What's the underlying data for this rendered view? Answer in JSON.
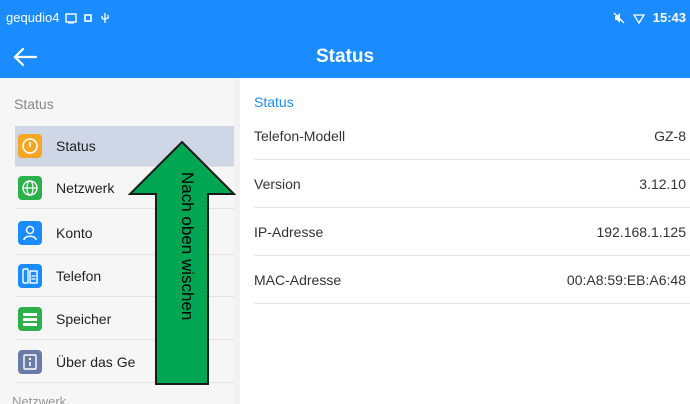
{
  "status_bar": {
    "user": "gequdio4",
    "time": "15:43"
  },
  "app_bar": {
    "title": "Status"
  },
  "sidebar": {
    "header": "Status",
    "items": [
      {
        "label": "Status",
        "icon": "clock-icon",
        "color": "#f5a623"
      },
      {
        "label": "Netzwerk",
        "icon": "globe-icon",
        "color": "#2bb04a"
      },
      {
        "label": "Konto",
        "icon": "user-icon",
        "color": "#1a8cff"
      },
      {
        "label": "Telefon",
        "icon": "desk-phone-icon",
        "color": "#1a8cff"
      },
      {
        "label": "Speicher",
        "icon": "storage-icon",
        "color": "#2bb04a"
      },
      {
        "label": "Über das Ge",
        "icon": "info-icon",
        "color": "#6b7ba8"
      }
    ],
    "footer": "Netzwerk"
  },
  "main": {
    "section_title": "Status",
    "rows": [
      {
        "label": "Telefon-Modell",
        "value": "GZ-8"
      },
      {
        "label": "Version",
        "value": "3.12.10"
      },
      {
        "label": "IP-Adresse",
        "value": "192.168.1.125"
      },
      {
        "label": "MAC-Adresse",
        "value": "00:A8:59:EB:A6:48"
      }
    ]
  },
  "overlay": {
    "text": "Nach oben wischen",
    "color": "#00a651"
  },
  "colors": {
    "accent": "#1a8cff",
    "active_item": "#cfd6e6"
  }
}
